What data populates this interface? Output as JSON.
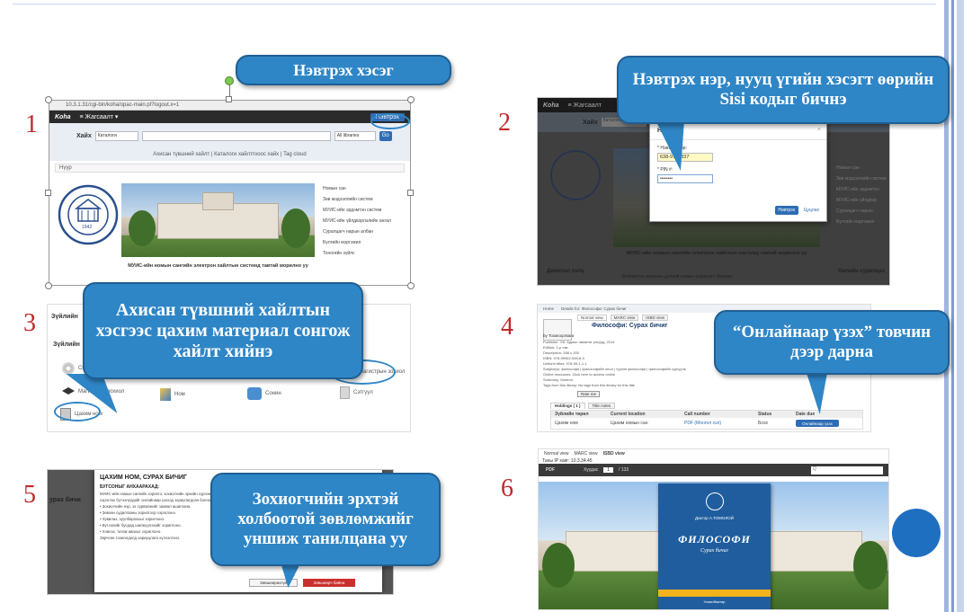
{
  "callouts": {
    "c1": "Нэвтрэх хэсэг",
    "c2": "Нэвтрэх нэр, нууц үгийн хэсэгт өөрийн Sisi кодыг бичнэ",
    "c3": "Ахисан түвшний хайлтын хэсгээс цахим материал сонгож хайлт хийнэ",
    "c4": "“Онлайнаар үзэх” товчин дээр дарна",
    "c5": "Зохиогчийн эрхтэй холбоотой зөвлөмжийг уншиж танилцана уу"
  },
  "steps": [
    "1",
    "2",
    "3",
    "4",
    "5",
    "6"
  ],
  "shot1": {
    "url": "10.3.1.31/cgi-bin/koha/opac-main.pl?logout.x=1",
    "logo": "Koha",
    "nav": "≡ Жагсаалт ▾",
    "login": "Нэвтрэх",
    "search_label": "Хайх",
    "search_select": "Каталоги",
    "libraries": "All libraries",
    "go": "Go",
    "links": "Ахисан түвшний хайлт | Каталоги хайлтгооос хайх | Tag cloud",
    "breadcrumb": "Нүүр",
    "menu": [
      "Номын сан",
      "Зөв мэдээллийн систем",
      "МУИС-ийн эрдэмтэн систем",
      "МУИС-ийн үйлдвэрлэлийн ангал",
      "Суралцагч нарын албан",
      "Бүлгийн мэргэжил",
      "Тоногийн зүйлс"
    ],
    "caption": "МУИС-ийн номын сангийн электрон хайлтын системд тавтай морилно уу",
    "seal_year": "1942"
  },
  "shot2": {
    "logo": "Koha",
    "nav": "≡ Жагсаалт",
    "search_label": "Хайх",
    "search_select": "Каталоги",
    "modal_title": "Нэвтрэх",
    "user_label": "* Нэвтрэх нэр:",
    "user_value": "638-9764337",
    "pin_label": "* PIN #:",
    "pin_value": "••••••••",
    "login_btn": "Нэвтрэх",
    "cancel": "Цуцлах",
    "menu": [
      "Номын сан",
      "Зөв мэдээллийн систем",
      "МУИС-ийн эрдэмтэн",
      "МУИС-ийн үйлдвэр",
      "Суралцагч нарын",
      "Бүлгийн мэргэжил"
    ],
    "caption": "МУИС-ийн номын сангийн электрон хайлтын системд тавтай морилно уу",
    "footer_left": "Дижитал хэлц",
    "footer_mid": "Библиотек анализы дэлхий номын хэрэглэгч Москва",
    "footer_right": "Онлайн суралцах",
    "seal_year": "1942"
  },
  "shot3": {
    "title": "Зүйлийн",
    "subtitle": "Зүйлийн",
    "items": [
      "CD-диск",
      "Магистрын зохиол",
      "Ном",
      "Сонин",
      "Сэтгүүл",
      "Цахим ном",
      "Е-Магистрын зохиол"
    ]
  },
  "shot4": {
    "top_tabs": [
      "Home",
      "Details for: Философи: Сурах бичиг"
    ],
    "view_tabs": [
      "Normal view",
      "MARC view",
      "ISBD view"
    ],
    "title": "Философи: Сурах бичиг",
    "by": "by Тохмооргвага",
    "fields": [
      "Publisher: УБ: Адмон лимитэт улсууд, 2014",
      "Edition: 1-р хэв",
      "Description: 268 х 155",
      "ISBN: 978-99962-948-8-5",
      "Uniform titles: 978-99-1-1-1",
      "Subject(s): философи | философийн онол | түүхэн философи | философийн сургууль",
      "Online resources: Click here to access online",
      "Summary: Монгол",
      "Tags from this library: No tags from this library for this title"
    ],
    "rate": "Rate me",
    "holdings_tab": "Holdings ( 1 )",
    "title_notes": "Title notes",
    "columns": [
      "Зүйлийн төрөл",
      "Current location",
      "Call number",
      "Status",
      "Date due"
    ],
    "row": [
      "Цахим ном",
      "Цахим номын сан",
      "PDF (Монгол хэл)",
      "Боэх",
      ""
    ],
    "online_btn": "Онлайнаар үзэх"
  },
  "shot5": {
    "title": "ЦАХИМ НОМ, СУРАХ БИЧИГ",
    "left_text": "урах бичи",
    "heading": "БУГСОНЫГ АНХААРАХАД:",
    "lines": [
      "МУИС-ийн номын сангийн зорилго, зохиогчийн эрхийн хүрээнд сурахад",
      "хэрэглэх бүтээлүүдийг онлайнаар үзэхэд зориулагдсан болно.",
      "• Зохиогчийн нэр, эх сурвалжийг заавал ашиглана.",
      "• Зөвхөн судалгааны зорилгоор хэрэглэнэ.",
      "• Хувилах, хуулбарлахыг хориглоно.",
      "• Бүтээлийг бусдад шилжүүлэхийг хориглоно.",
      "• Хэвлэх, татаж авахыг хориглоно.",
      "Зөрчсөн тохиолдолд хариуцлага хүлээлгэнэ."
    ],
    "btn_left": "Зөвшөөрөхгүй",
    "btn_right": "Зөвшөөрч байна"
  },
  "shot6": {
    "tabs": [
      "Normal view",
      "MARC view",
      "ISBD view"
    ],
    "ip": "Таны IP хаяг: 10.3.34.45",
    "pdf": "PDF",
    "page_label": "Хуудас",
    "page_num": "1",
    "page_total": "/ 133",
    "book_author": "Доктор А.ТОМОЛОЙ",
    "book_title": "ФИЛОСОФИ",
    "book_sub": "Сурах бичиг",
    "book_city": "Улаанбаатар"
  },
  "colors": {
    "callout": "#2f86c6",
    "number": "#c0282c",
    "stripe": "#9fb6dc",
    "koha_bar": "#2b2b2b"
  }
}
